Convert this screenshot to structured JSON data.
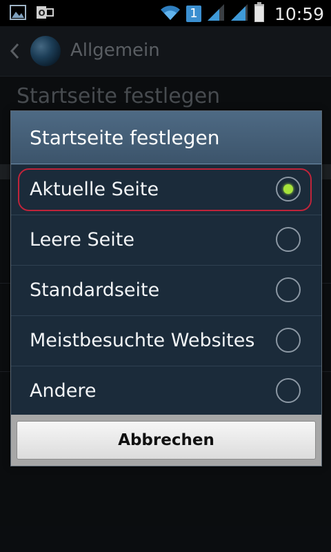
{
  "status_bar": {
    "time": "10:59",
    "notification_count": "1",
    "icons": [
      "gallery-icon",
      "outlook-icon",
      "wifi-icon",
      "notification-badge",
      "signal-icon",
      "signal-icon-2",
      "battery-icon"
    ]
  },
  "action_bar": {
    "title": "Allgemein",
    "back_icon": "chevron-left-icon",
    "app_icon": "globe-icon"
  },
  "background": {
    "section_title": "Startseite festlegen"
  },
  "dialog": {
    "title": "Startseite festlegen",
    "options": [
      {
        "label": "Aktuelle Seite",
        "selected": true
      },
      {
        "label": "Leere Seite",
        "selected": false
      },
      {
        "label": "Standardseite",
        "selected": false
      },
      {
        "label": "Meistbesuchte Websites",
        "selected": false
      },
      {
        "label": "Andere",
        "selected": false
      }
    ],
    "cancel_label": "Abbrechen"
  },
  "colors": {
    "dialog_header": "#46607a",
    "dialog_body": "#1b2b3a",
    "selected_dot": "#a7e33b",
    "highlight_ring": "#c0243a"
  }
}
